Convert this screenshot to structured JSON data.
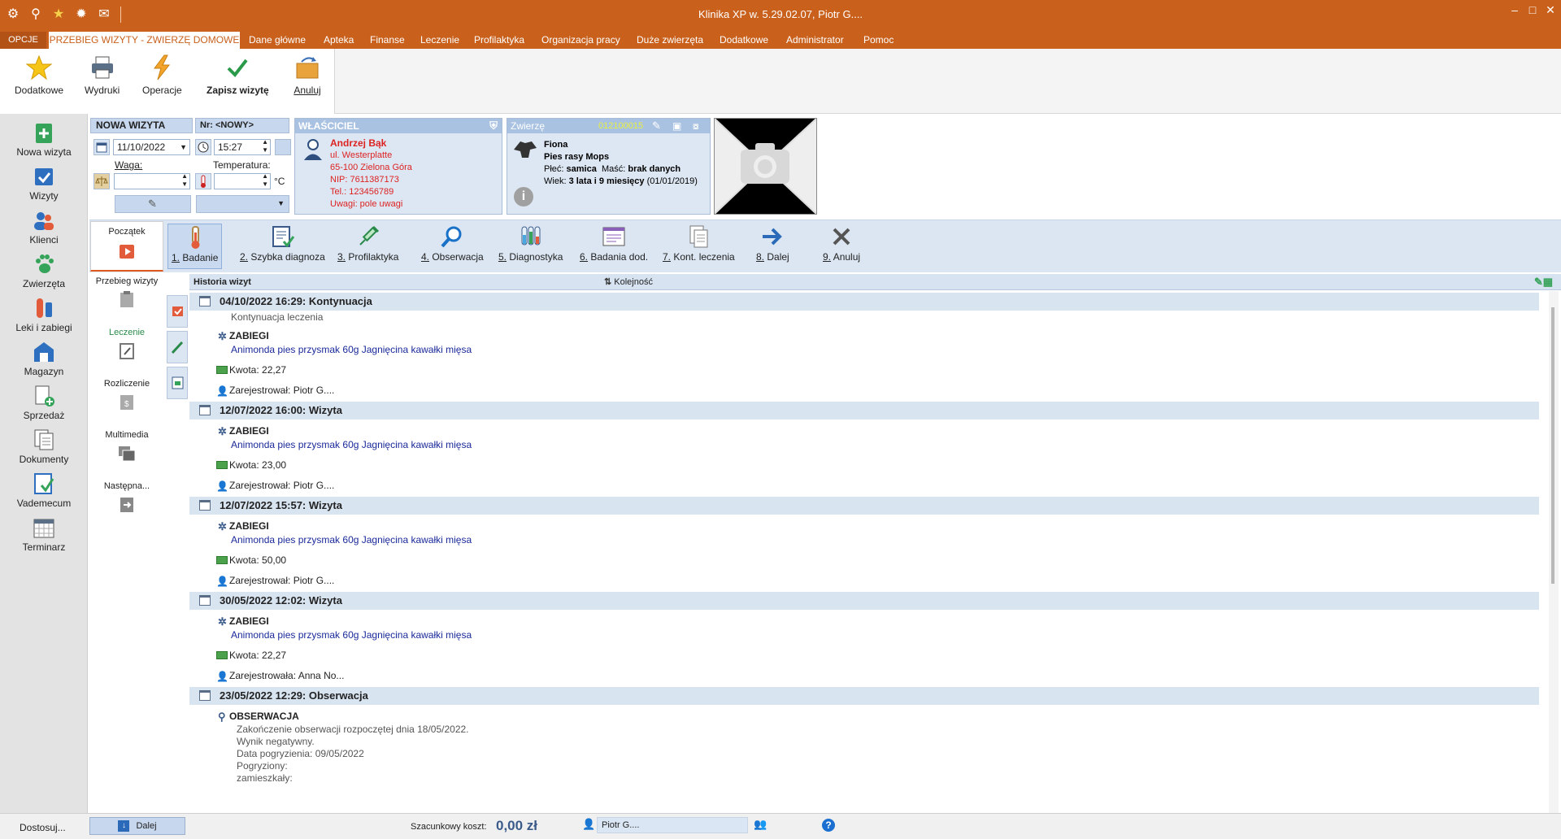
{
  "app": {
    "title": "Klinika XP w. 5.29.02.07, Piotr G....",
    "window_controls": [
      "–",
      "□",
      "✕"
    ]
  },
  "menu": {
    "opcje": "OPCJE",
    "active_tab": "PRZEBIEG WIZYTY - ZWIERZĘ DOMOWE",
    "items": [
      "Dane główne",
      "Apteka",
      "Finanse",
      "Leczenie",
      "Profilaktyka",
      "Organizacja pracy",
      "Duże zwierzęta",
      "Dodatkowe",
      "Administrator",
      "Pomoc"
    ]
  },
  "ribbon": {
    "dodatkowe": "Dodatkowe",
    "wydruki": "Wydruki",
    "operacje": "Operacje",
    "zapisz": "Zapisz wizytę",
    "anuluj": "Anuluj"
  },
  "leftnav": [
    "Nowa wizyta",
    "Wizyty",
    "Klienci",
    "Zwierzęta",
    "Leki i zabiegi",
    "Magazyn",
    "Sprzedaż",
    "Dokumenty",
    "Vademecum",
    "Terminarz"
  ],
  "visit": {
    "title": "NOWA WIZYTA",
    "number": "Nr: <NOWY>",
    "date": "11/10/2022",
    "time": "15:27",
    "weight_label": "Waga:",
    "temp_label": "Temperatura:",
    "temp_unit": "°C"
  },
  "owner": {
    "header": "WŁAŚCICIEL",
    "name": "Andrzej Bąk",
    "street": "ul. Westerplatte",
    "city": "65-100  Zielona Góra",
    "nip": "NIP: 7611387173",
    "tel": "Tel.: 123456789",
    "notes": "Uwagi: pole uwagi"
  },
  "pet": {
    "header": "Zwierzę",
    "code": "012100015",
    "name": "Fiona",
    "breed_prefix": "Pies rasy ",
    "breed": "Mops",
    "sex_label": "Płeć: ",
    "sex": "samica",
    "coat_label": "  Maść: ",
    "coat": "brak danych",
    "age_label": "Wiek: ",
    "age": "3 lata i 9 miesięcy",
    "birth": " (01/01/2019)"
  },
  "steps": {
    "start": "Początek",
    "items": [
      {
        "num": "1.",
        "label": " Badanie"
      },
      {
        "num": "2.",
        "label": " Szybka diagnoza"
      },
      {
        "num": "3.",
        "label": " Profilaktyka"
      },
      {
        "num": "4.",
        "label": " Obserwacja"
      },
      {
        "num": "5.",
        "label": " Diagnostyka"
      },
      {
        "num": "6.",
        "label": " Badania dod."
      },
      {
        "num": "7.",
        "label": " Kont. leczenia"
      },
      {
        "num": "8.",
        "label": " Dalej"
      },
      {
        "num": "9.",
        "label": " Anuluj"
      }
    ]
  },
  "sections": [
    "Przebieg wizyty",
    "Leczenie",
    "Rozliczenie",
    "Multimedia",
    "Następna..."
  ],
  "history": {
    "header": "Historia wizyt",
    "order": "Kolejność",
    "entries": [
      {
        "title": "04/10/2022 16:29: Kontynuacja",
        "sub": "Kontynuacja leczenia",
        "section": "ZABIEGI",
        "item": "Animonda pies przysmak 60g Jagnięcina kawałki mięsa",
        "amount": "Kwota: 22,27",
        "reg": "Zarejestrował: Piotr G...."
      },
      {
        "title": "12/07/2022 16:00: Wizyta",
        "section": "ZABIEGI",
        "item": "Animonda pies przysmak 60g Jagnięcina kawałki mięsa",
        "amount": "Kwota: 23,00",
        "reg": "Zarejestrował: Piotr G...."
      },
      {
        "title": "12/07/2022 15:57: Wizyta",
        "section": "ZABIEGI",
        "item": "Animonda pies przysmak 60g Jagnięcina kawałki mięsa",
        "amount": "Kwota: 50,00",
        "reg": "Zarejestrował: Piotr G...."
      },
      {
        "title": "30/05/2022 12:02: Wizyta",
        "section": "ZABIEGI",
        "item": "Animonda pies przysmak 60g Jagnięcina kawałki mięsa",
        "amount": "Kwota: 22,27",
        "reg": "Zarejestrowała: Anna No..."
      }
    ],
    "obs": {
      "title": "23/05/2022 12:29: Obserwacja",
      "section": "OBSERWACJA",
      "lines": [
        "Zakończenie obserwacji rozpoczętej dnia 18/05/2022.",
        "Wynik negatywny.",
        "Data pogryzienia: 09/05/2022",
        "Pogryziony:",
        "zamieszkały:"
      ]
    }
  },
  "status": {
    "dostosuj": "Dostosuj...",
    "dalej": "Dalej",
    "cost_label": "Szacunkowy koszt:",
    "cost_value": "0,00 zł",
    "user": "Piotr G....",
    "help": "?"
  }
}
